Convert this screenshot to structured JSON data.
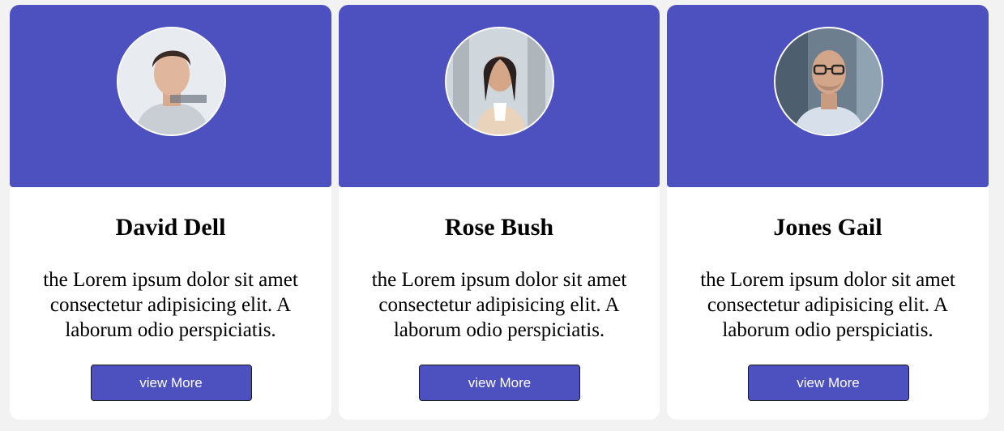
{
  "cards": [
    {
      "name": "David Dell",
      "description": "the Lorem ipsum dolor sit amet consectetur adipisicing elit. A laborum odio perspiciatis.",
      "button_label": "view More",
      "avatar_icon": "profile-photo"
    },
    {
      "name": "Rose Bush",
      "description": "the Lorem ipsum dolor sit amet consectetur adipisicing elit. A laborum odio perspiciatis.",
      "button_label": "view More",
      "avatar_icon": "profile-photo"
    },
    {
      "name": "Jones Gail",
      "description": "the Lorem ipsum dolor sit amet consectetur adipisicing elit. A laborum odio perspiciatis.",
      "button_label": "view More",
      "avatar_icon": "profile-photo"
    }
  ],
  "colors": {
    "accent": "#4c51bf",
    "card_background": "#ffffff",
    "page_background": "#f2f2f2"
  }
}
